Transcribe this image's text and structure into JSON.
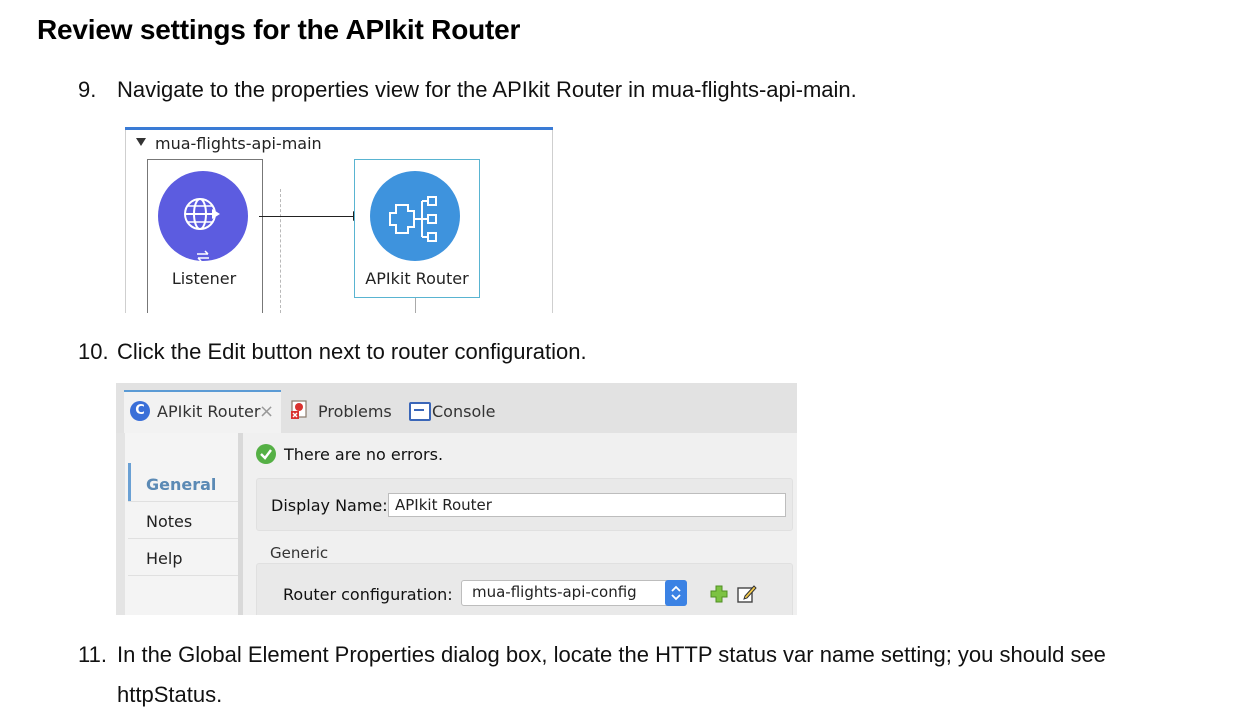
{
  "heading": "Review settings for the APIkit Router",
  "steps": [
    {
      "num": "9.",
      "text": "Navigate to the properties view for the APIkit Router in mua-flights-api-main."
    },
    {
      "num": "10.",
      "text": "Click the Edit button next to router configuration."
    },
    {
      "num": "11.",
      "text": "In the Global Element Properties dialog box, locate the HTTP status var name setting; you should see",
      "text2": "httpStatus."
    }
  ],
  "flow": {
    "name": "mua-flights-api-main",
    "listener_label": "Listener",
    "router_label": "APIkit Router",
    "listener_color": "#5c5ce0",
    "router_color": "#3e93dd"
  },
  "panel": {
    "tabs": {
      "active": "APIkit Router",
      "problems": "Problems",
      "console": "Console"
    },
    "status": "There are no errors.",
    "nav": [
      "General",
      "Notes",
      "Help"
    ],
    "display_name_label": "Display Name:",
    "display_name_value": "APIkit Router",
    "section": "Generic",
    "router_config_label": "Router configuration:",
    "router_config_value": "mua-flights-api-config"
  }
}
